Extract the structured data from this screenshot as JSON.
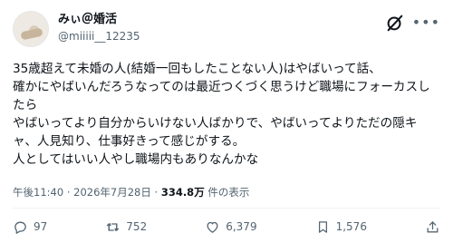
{
  "author": {
    "display_name": "みぃ＠婚活",
    "handle": "@miiiii__12235"
  },
  "icons": {
    "grok": "grok-icon",
    "more": "more-icon",
    "reply": "reply-icon",
    "repost": "repost-icon",
    "like": "heart-icon",
    "views": "views-icon",
    "bookmark": "bookmark-icon",
    "share": "share-icon"
  },
  "post": {
    "lines": [
      "35歳超えて未婚の人(結婚一回もしたことない人)はやばいって話、",
      "確かにやばいんだろうなってのは最近つくづく思うけど職場にフォーカスし",
      "たら",
      "やばいってより自分からいけない人ばかりで、やばいってよりただの隠キ",
      "ャ、人見知り、仕事好きって感じがする。",
      "人としてはいい人やし職場内もありなんかな"
    ]
  },
  "meta": {
    "time": "午後11:40",
    "separator": "·",
    "date": "2026年7月28日",
    "views_count": "334.8万",
    "views_label": "件の表示"
  },
  "stats": {
    "replies": "97",
    "reposts": "752",
    "likes": "6,379",
    "views": "1,576"
  }
}
